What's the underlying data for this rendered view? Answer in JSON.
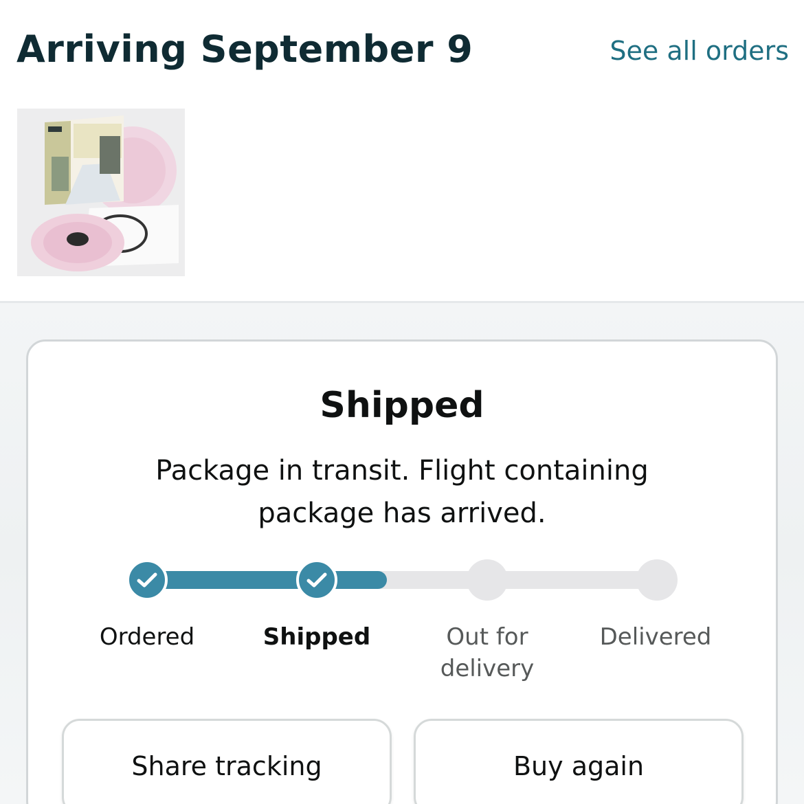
{
  "header": {
    "title": "Arriving September 9",
    "see_all_orders": "See all orders"
  },
  "status": {
    "title": "Shipped",
    "description": "Package in transit. Flight containing package has arrived."
  },
  "progress": {
    "fraction": 0.47,
    "steps": [
      {
        "label": "Ordered",
        "state": "done"
      },
      {
        "label": "Shipped",
        "state": "current"
      },
      {
        "label": "Out for delivery",
        "state": "pending"
      },
      {
        "label": "Delivered",
        "state": "pending"
      }
    ]
  },
  "actions": {
    "share_tracking": "Share tracking",
    "buy_again": "Buy again"
  },
  "colors": {
    "accent": "#3b8aa6",
    "link": "#1f6f82",
    "pending": "#e6e6e8"
  }
}
